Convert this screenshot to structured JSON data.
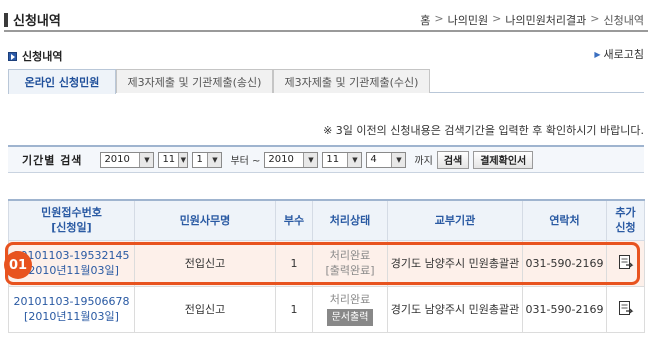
{
  "header": {
    "title": "신청내역",
    "breadcrumb": [
      "홈",
      "나의민원",
      "나의민원처리결과",
      "신청내역"
    ],
    "separator": ">"
  },
  "sub": {
    "title": "신청내역",
    "refresh_label": "새로고침"
  },
  "tabs": [
    {
      "label": "온라인 신청민원",
      "active": true
    },
    {
      "label": "제3자제출 및 기관제출(송신)",
      "active": false
    },
    {
      "label": "제3자제출 및 기관제출(수신)",
      "active": false
    }
  ],
  "notice": "※ 3일 이전의 신청내용은 검색기간을 입력한 후 확인하시기 바랍니다.",
  "period": {
    "label": "기간별 검색",
    "from": {
      "year": "2010",
      "month": "11",
      "day": "1"
    },
    "from_suffix": "부터 ~",
    "to": {
      "year": "2010",
      "month": "11",
      "day": "4"
    },
    "to_suffix": "까지",
    "search_button": "검색",
    "confirm_button": "결제확인서"
  },
  "table": {
    "headers": {
      "receipt": "민원접수번호",
      "receipt_date": "[신청일]",
      "name": "민원사무명",
      "copies": "부수",
      "status": "처리상태",
      "agency": "교부기관",
      "contact": "연락처",
      "extra1": "추가",
      "extra2": "신청"
    },
    "rows": [
      {
        "receipt": "20101103-19532145",
        "date": "[2010년11월03일]",
        "name": "전입신고",
        "copies": "1",
        "status": "처리완료",
        "status_sub": "[출력완료]",
        "agency": "경기도 남양주시 민원총괄관",
        "contact": "031-590-2169",
        "icon": "document-request-icon"
      },
      {
        "receipt": "20101103-19506678",
        "date": "[2010년11월03일]",
        "name": "전입신고",
        "copies": "1",
        "status": "처리완료",
        "status_sub": "문서출력",
        "agency": "경기도 남양주시 민원총괄관",
        "contact": "031-590-2169",
        "icon": "document-request-icon"
      }
    ]
  },
  "callout": {
    "badge": "01",
    "color": "#e8531f"
  }
}
